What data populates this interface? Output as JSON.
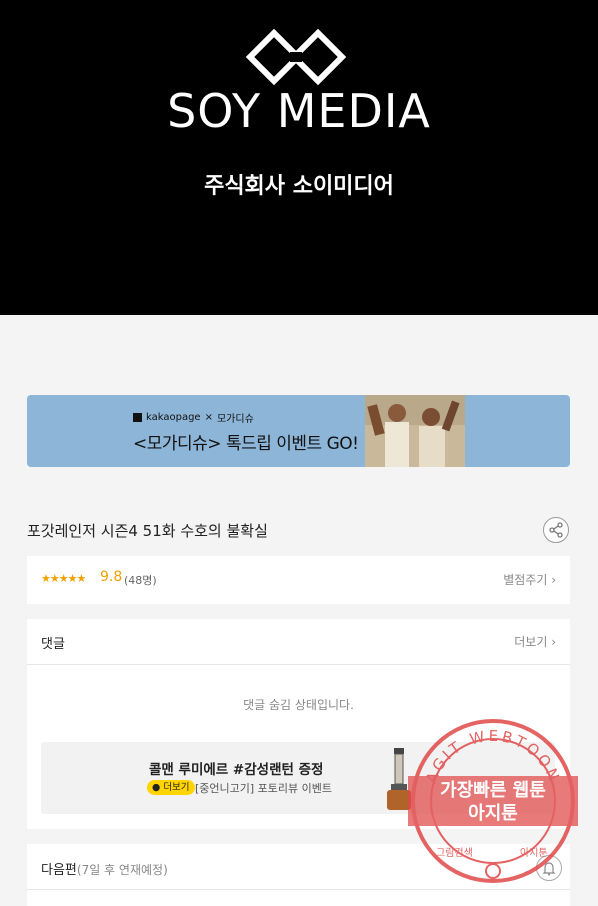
{
  "header": {
    "logo_text": "SOY MEDIA",
    "company_name": "주식회사 소이미디어"
  },
  "banner": {
    "brand_kakao": "kakaopage",
    "brand_x": "×",
    "brand_partner": "모가디슈",
    "headline": "<모가디슈> 톡드립 이벤트 GO!"
  },
  "episode": {
    "title": "포갓레인저 시즌4 51화 수호의 불확실"
  },
  "rating": {
    "stars": "★★★★★",
    "score": "9.8",
    "count": "(48명)",
    "rate_link": "별점주기 ›"
  },
  "comments": {
    "header": "댓글",
    "more": "더보기 ›",
    "hidden_message": "댓글 숨김 상태입니다.",
    "promo": {
      "title": "콜맨 루미에르 #감성랜턴 증정",
      "pill_label": "더보기",
      "subtitle": "[중언니고기] 포토리뷰 이벤트"
    }
  },
  "next_episode": {
    "label": "다음편",
    "note": "(7일 후 연재예정)"
  },
  "watermark": {
    "line1": "가장빠른 웹툰",
    "line2": "아지툰",
    "ring_text": "AGIT WEBTOON",
    "bottom_left": "그림검색",
    "bottom_right": "아지툰"
  },
  "colors": {
    "rating_accent": "#f0a000",
    "banner_bg": "#8db5d8",
    "pill_bg": "#ffd400",
    "stamp": "#e04848"
  }
}
